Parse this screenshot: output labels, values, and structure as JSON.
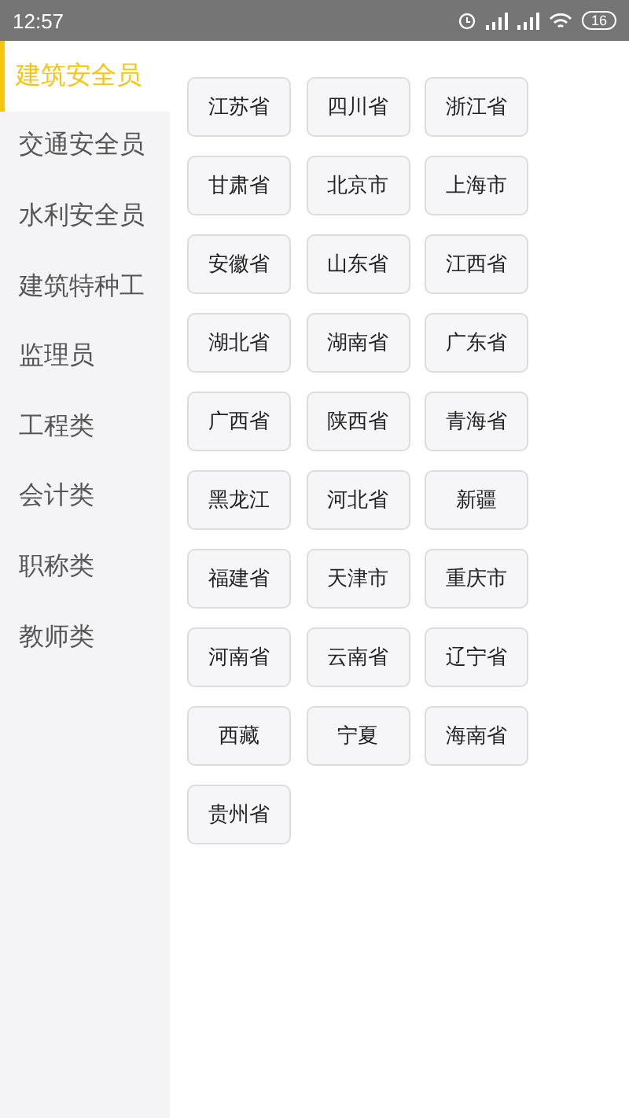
{
  "status_bar": {
    "time": "12:57",
    "battery": "16"
  },
  "sidebar": {
    "items": [
      {
        "label": "建筑安全员",
        "selected": true
      },
      {
        "label": "交通安全员",
        "selected": false
      },
      {
        "label": "水利安全员",
        "selected": false
      },
      {
        "label": "建筑特种工",
        "selected": false
      },
      {
        "label": "监理员",
        "selected": false
      },
      {
        "label": "工程类",
        "selected": false
      },
      {
        "label": "会计类",
        "selected": false
      },
      {
        "label": "职称类",
        "selected": false
      },
      {
        "label": "教师类",
        "selected": false
      }
    ]
  },
  "regions": [
    "江苏省",
    "四川省",
    "浙江省",
    "甘肃省",
    "北京市",
    "上海市",
    "安徽省",
    "山东省",
    "江西省",
    "湖北省",
    "湖南省",
    "广东省",
    "广西省",
    "陕西省",
    "青海省",
    "黑龙江",
    "河北省",
    "新疆",
    "福建省",
    "天津市",
    "重庆市",
    "河南省",
    "云南省",
    "辽宁省",
    "西藏",
    "宁夏",
    "海南省",
    "贵州省"
  ]
}
